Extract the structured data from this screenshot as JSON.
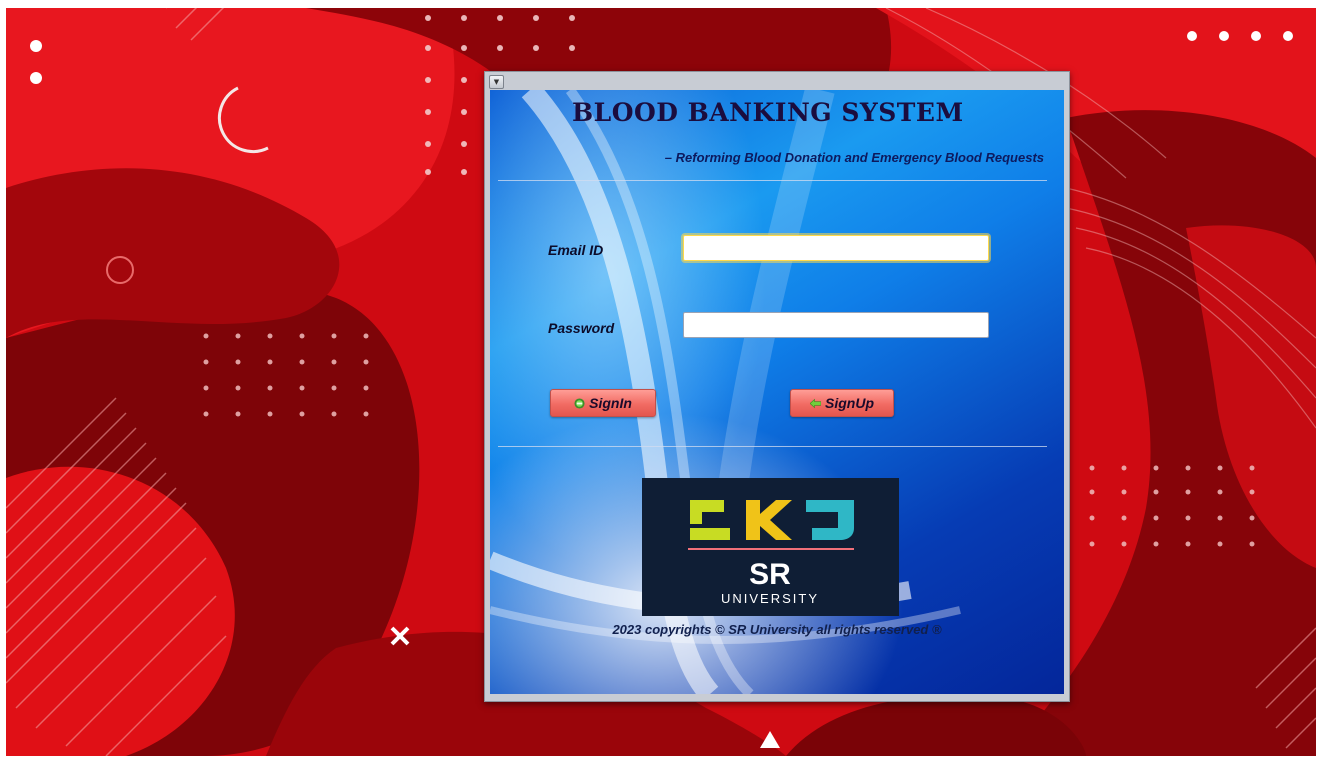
{
  "colors": {
    "background_red": "#d40d15",
    "window_blue": "#0f7ee8",
    "button_red": "#f16b63",
    "field_focus": "#ffd94a",
    "logo_bg": "#0f1e35",
    "logo_yellow_green": "#c8dc23",
    "logo_yellow": "#f0c318",
    "logo_teal": "#2fb7c6",
    "logo_line": "#f0707a"
  },
  "background": {
    "decorations": [
      "circle-arc",
      "ring",
      "dot-grid",
      "close-mark",
      "triangle-mark",
      "diagonal-lines"
    ]
  },
  "window": {
    "title": "BLOOD  BANKING SYSTEM",
    "tagline": "– Reforming Blood Donation and Emergency Blood Requests",
    "menu_icon": "chevron-down-icon"
  },
  "form": {
    "email_label": "Email ID",
    "email_value": "",
    "password_label": "Password",
    "password_value": ""
  },
  "buttons": {
    "signin_label": "SignIn",
    "signin_icon": "circle-dot-icon",
    "signup_label": "SignUp",
    "signup_icon": "arrow-left-icon"
  },
  "logo": {
    "text": "SR",
    "subtext": "UNIVERSITY"
  },
  "footer": {
    "copyright": "2023 copyrights © SR University all rights reserved ®"
  }
}
